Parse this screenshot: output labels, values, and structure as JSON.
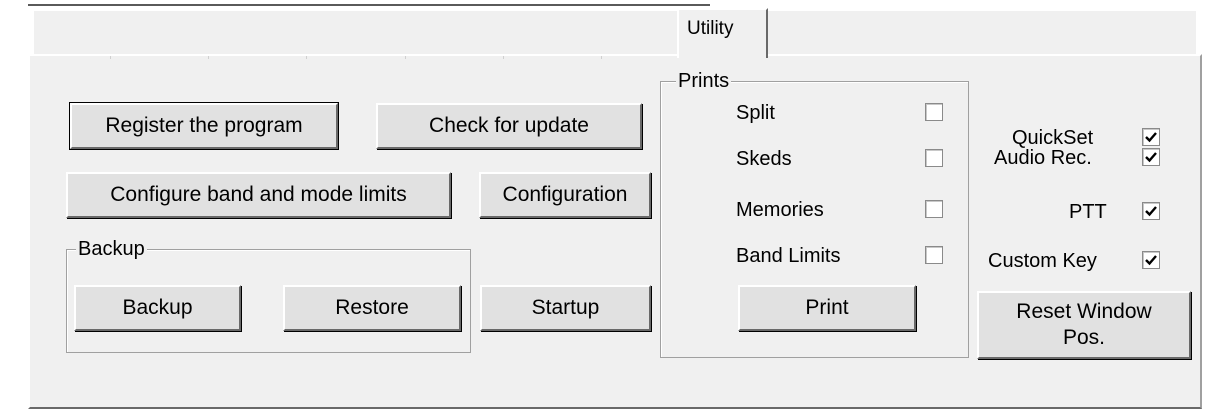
{
  "tabs": {
    "active_label": "Utility"
  },
  "buttons": {
    "register": "Register the program",
    "check_update": "Check for update",
    "configure_limits": "Configure band and mode limits",
    "configuration": "Configuration",
    "startup": "Startup",
    "print": "Print",
    "reset_window": "Reset Window Pos."
  },
  "backup_group": {
    "legend": "Backup",
    "backup_button": "Backup",
    "restore_button": "Restore"
  },
  "prints_group": {
    "legend": "Prints",
    "items": [
      {
        "label": "Split",
        "checked": false
      },
      {
        "label": "Skeds",
        "checked": false
      },
      {
        "label": "Memories",
        "checked": false
      },
      {
        "label": "Band Limits",
        "checked": false
      }
    ]
  },
  "options": [
    {
      "label": "QuickSet",
      "checked": true
    },
    {
      "label": "Audio Rec.",
      "checked": true
    },
    {
      "label": "PTT",
      "checked": true
    },
    {
      "label": "Custom Key",
      "checked": true
    }
  ]
}
